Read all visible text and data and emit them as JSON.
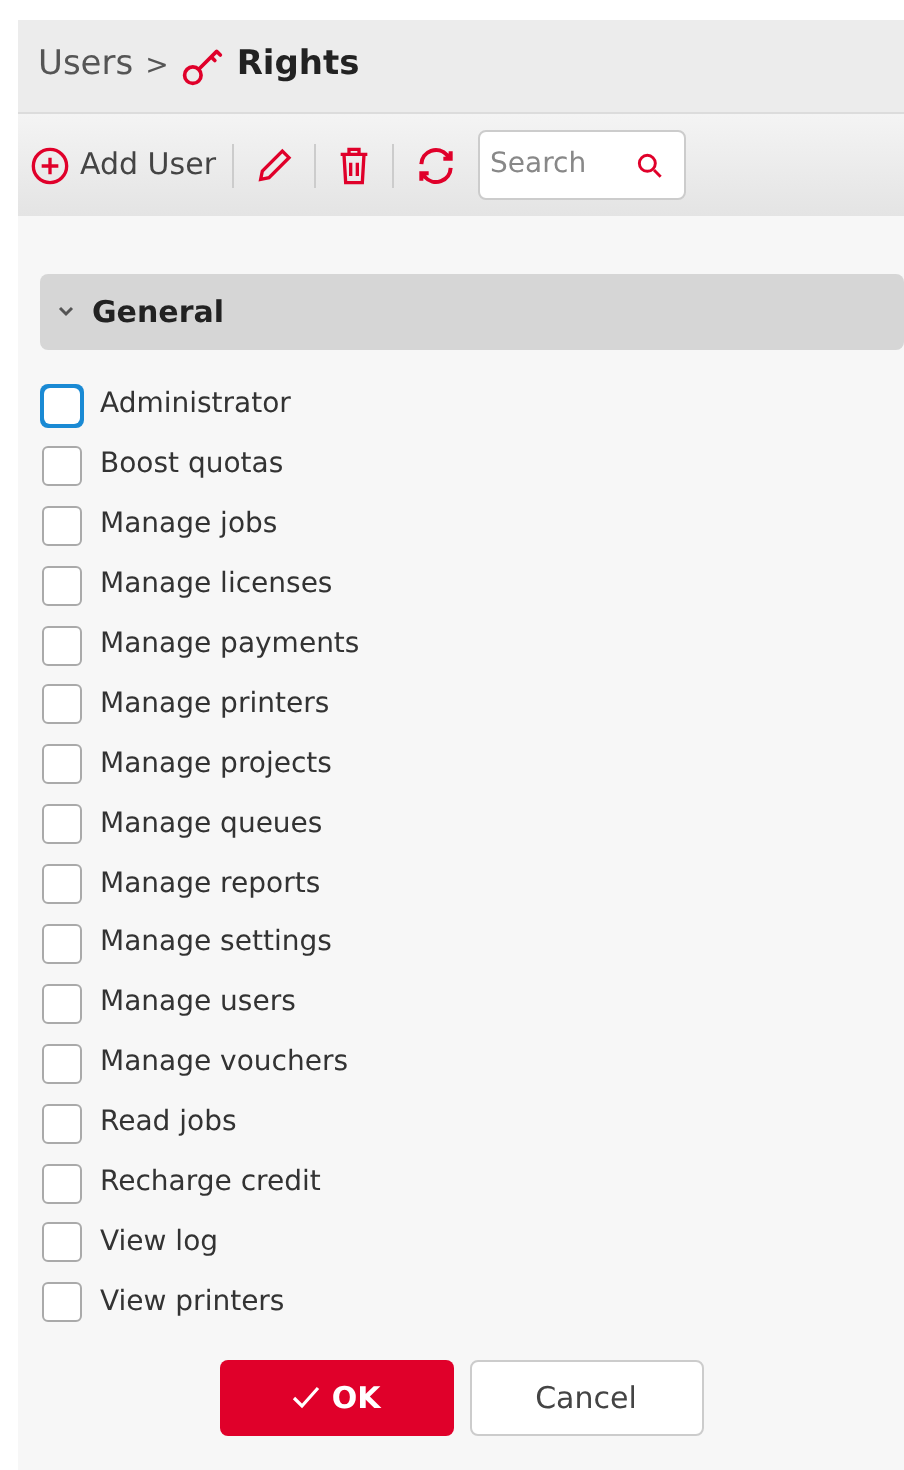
{
  "breadcrumb": {
    "parent": "Users",
    "separator": ">",
    "current": "Rights"
  },
  "toolbar": {
    "add_label": "Add User",
    "search": {
      "placeholder": "Search"
    }
  },
  "section": {
    "title": "General",
    "expanded": true,
    "items": [
      {
        "label": "Administrator",
        "checked": false,
        "focused": true
      },
      {
        "label": "Boost quotas",
        "checked": false,
        "focused": false
      },
      {
        "label": "Manage jobs",
        "checked": false,
        "focused": false
      },
      {
        "label": "Manage licenses",
        "checked": false,
        "focused": false
      },
      {
        "label": "Manage payments",
        "checked": false,
        "focused": false
      },
      {
        "label": "Manage printers",
        "checked": false,
        "focused": false
      },
      {
        "label": "Manage projects",
        "checked": false,
        "focused": false
      },
      {
        "label": "Manage queues",
        "checked": false,
        "focused": false
      },
      {
        "label": "Manage reports",
        "checked": false,
        "focused": false
      },
      {
        "label": "Manage settings",
        "checked": false,
        "focused": false
      },
      {
        "label": "Manage users",
        "checked": false,
        "focused": false
      },
      {
        "label": "Manage vouchers",
        "checked": false,
        "focused": false
      },
      {
        "label": "Read jobs",
        "checked": false,
        "focused": false
      },
      {
        "label": "Recharge credit",
        "checked": false,
        "focused": false
      },
      {
        "label": "View log",
        "checked": false,
        "focused": false
      },
      {
        "label": "View printers",
        "checked": false,
        "focused": false
      }
    ]
  },
  "buttons": {
    "ok": "OK",
    "cancel": "Cancel"
  }
}
